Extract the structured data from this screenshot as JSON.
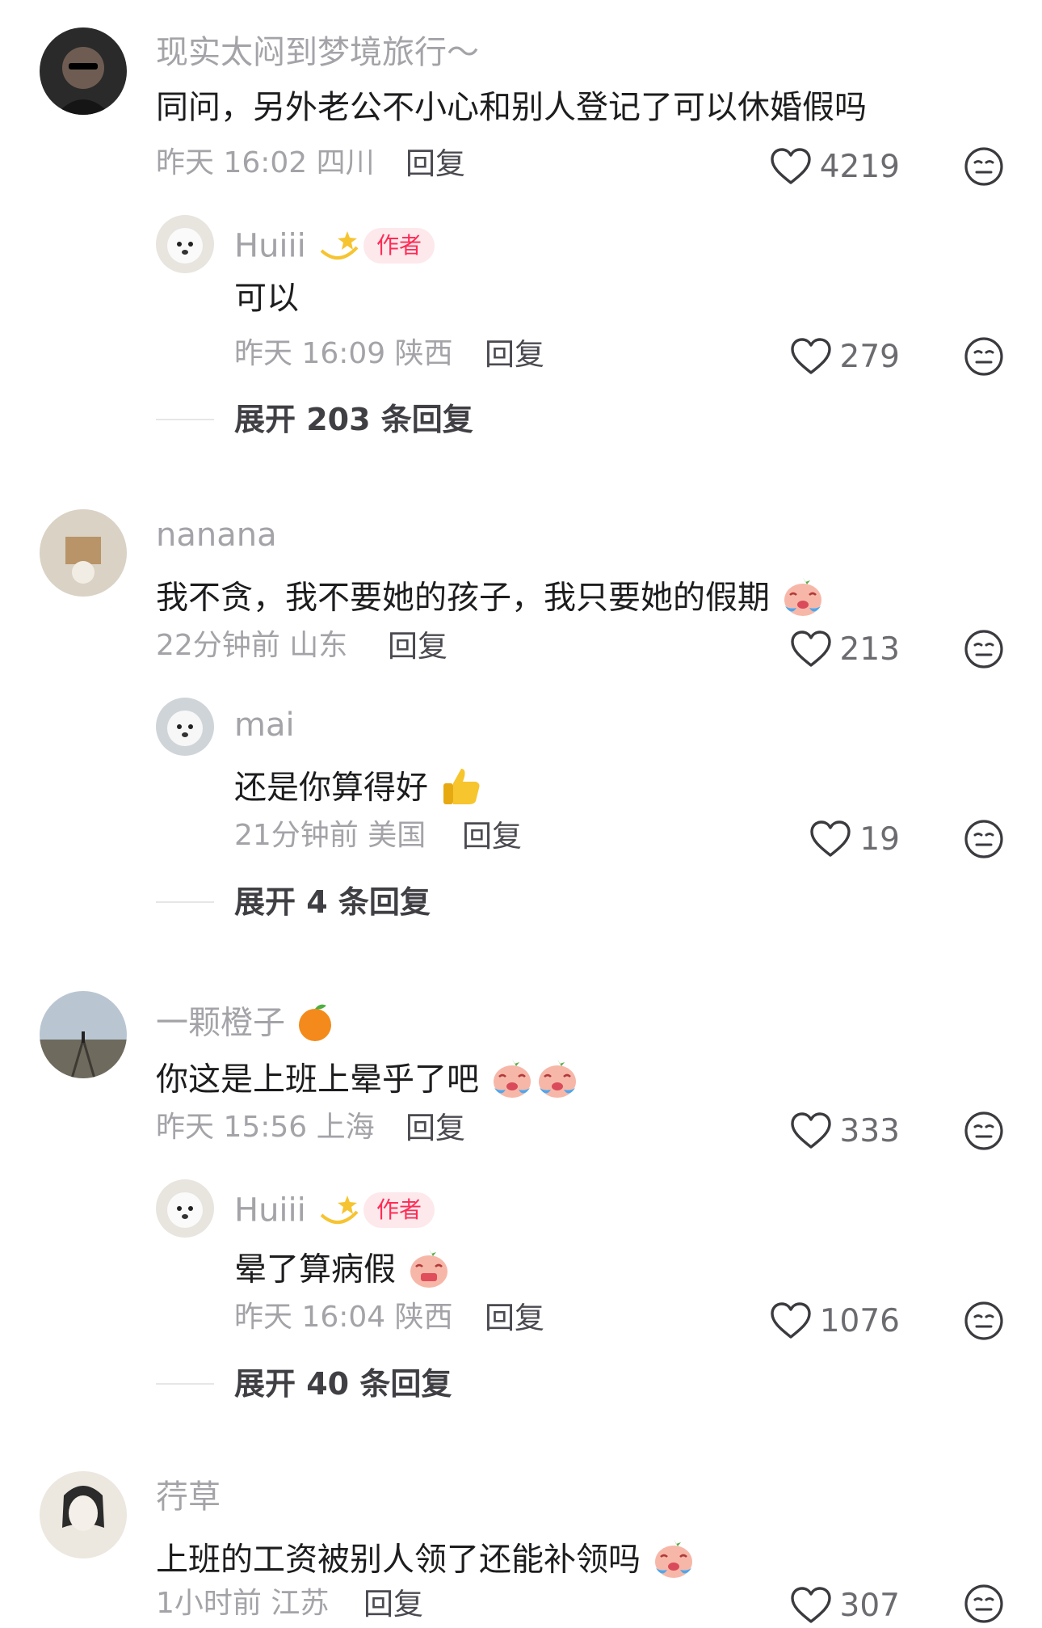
{
  "comments": [
    {
      "username": "现实太闷到梦境旅行～",
      "text": "同问，另外老公不小心和别人登记了可以休婚假吗",
      "time_location": "昨天 16:02 四川",
      "reply_label": "回复",
      "likes": "4219",
      "reply": {
        "username": "Huiii",
        "author_tag": "作者",
        "text": "可以",
        "time_location": "昨天 16:09 陕西",
        "reply_label": "回复",
        "likes": "279"
      },
      "expand_label": "展开 203 条回复"
    },
    {
      "username": "nanana",
      "text": "我不贪，我不要她的孩子，我只要她的假期",
      "time_location": "22分钟前 山东",
      "reply_label": "回复",
      "likes": "213",
      "reply": {
        "username": "mai",
        "text": "还是你算得好",
        "time_location": "21分钟前 美国",
        "reply_label": "回复",
        "likes": "19"
      },
      "expand_label": "展开 4 条回复"
    },
    {
      "username": "一颗橙子",
      "text": "你这是上班上晕乎了吧",
      "time_location": "昨天 15:56 上海",
      "reply_label": "回复",
      "likes": "333",
      "reply": {
        "username": "Huiii",
        "author_tag": "作者",
        "text": "晕了算病假",
        "time_location": "昨天 16:04 陕西",
        "reply_label": "回复",
        "likes": "1076"
      },
      "expand_label": "展开 40 条回复"
    },
    {
      "username": "荇草",
      "text": "上班的工资被别人领了还能补领吗",
      "time_location": "1小时前 江苏",
      "reply_label": "回复",
      "likes": "307"
    }
  ],
  "icons": {
    "like": "heart-outline-icon",
    "dislike": "neutral-face-icon"
  },
  "colors": {
    "author_tag_text": "#fe2c55",
    "author_tag_bg": "#fde8ec",
    "secondary_text": "#a3a3a8"
  }
}
